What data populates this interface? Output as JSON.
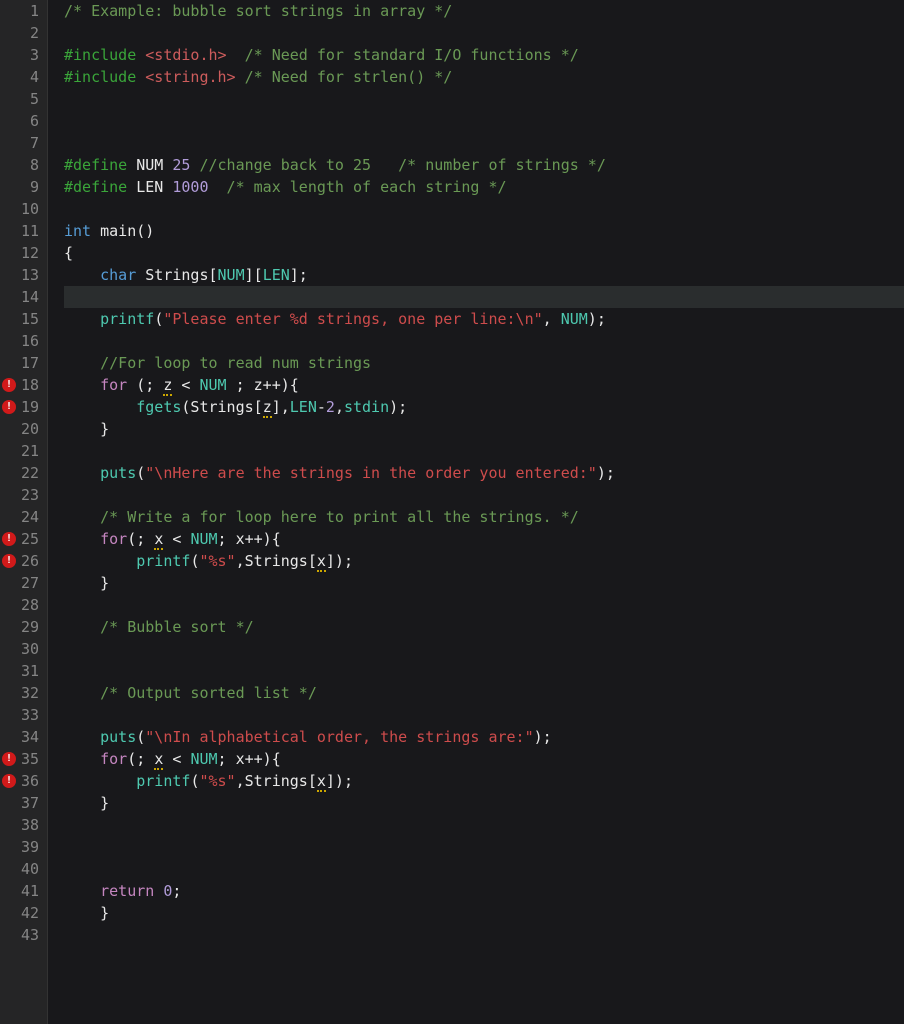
{
  "editor": {
    "total_lines": 43,
    "current_line": 14,
    "error_lines": [
      18,
      19,
      25,
      26,
      35,
      36
    ],
    "lines": {
      "1": [
        {
          "cls": "c-comment",
          "t": "/* Example: bubble sort strings in array */"
        }
      ],
      "2": [],
      "3": [
        {
          "cls": "c-preproc-green",
          "t": "#include "
        },
        {
          "cls": "c-include",
          "t": "<stdio.h>"
        },
        {
          "cls": "c-comment",
          "t": "  /* Need for standard I/O functions */"
        }
      ],
      "4": [
        {
          "cls": "c-preproc-green",
          "t": "#include "
        },
        {
          "cls": "c-include",
          "t": "<string.h>"
        },
        {
          "cls": "c-comment",
          "t": " /* Need for strlen() */"
        }
      ],
      "5": [],
      "6": [],
      "7": [],
      "8": [
        {
          "cls": "c-preproc-green",
          "t": "#define"
        },
        {
          "cls": "c-define-name",
          "t": " NUM "
        },
        {
          "cls": "c-number",
          "t": "25"
        },
        {
          "cls": "c-comment",
          "t": " //change back to 25   /* number of strings */"
        }
      ],
      "9": [
        {
          "cls": "c-preproc-green",
          "t": "#define"
        },
        {
          "cls": "c-define-name",
          "t": " LEN "
        },
        {
          "cls": "c-number",
          "t": "1000"
        },
        {
          "cls": "c-comment",
          "t": "  /* max length of each string */"
        }
      ],
      "10": [],
      "11": [
        {
          "cls": "c-type",
          "t": "int"
        },
        {
          "cls": "c-ident",
          "t": " main"
        },
        {
          "cls": "c-punct",
          "t": "()"
        }
      ],
      "12": [
        {
          "cls": "c-punct",
          "t": "{"
        }
      ],
      "13": [
        {
          "cls": "c-ident",
          "t": "    "
        },
        {
          "cls": "c-type",
          "t": "char"
        },
        {
          "cls": "c-ident",
          "t": " Strings["
        },
        {
          "cls": "c-macro",
          "t": "NUM"
        },
        {
          "cls": "c-ident",
          "t": "]["
        },
        {
          "cls": "c-macro",
          "t": "LEN"
        },
        {
          "cls": "c-ident",
          "t": "];"
        }
      ],
      "14": [],
      "15": [
        {
          "cls": "c-ident",
          "t": "    "
        },
        {
          "cls": "c-func",
          "t": "printf"
        },
        {
          "cls": "c-punct",
          "t": "("
        },
        {
          "cls": "c-string",
          "t": "\"Please enter %d strings, one per line:\\n\""
        },
        {
          "cls": "c-punct",
          "t": ", "
        },
        {
          "cls": "c-macro",
          "t": "NUM"
        },
        {
          "cls": "c-punct",
          "t": ");"
        }
      ],
      "16": [],
      "17": [
        {
          "cls": "c-ident",
          "t": "    "
        },
        {
          "cls": "c-comment",
          "t": "//For loop to read num strings"
        }
      ],
      "18": [
        {
          "cls": "c-ident",
          "t": "    "
        },
        {
          "cls": "c-keyword",
          "t": "for"
        },
        {
          "cls": "c-ident",
          "t": " (; "
        },
        {
          "cls": "c-ident warn-underline",
          "t": "z"
        },
        {
          "cls": "c-ident",
          "t": " < "
        },
        {
          "cls": "c-macro",
          "t": "NUM"
        },
        {
          "cls": "c-ident",
          "t": " ; z++){"
        }
      ],
      "19": [
        {
          "cls": "c-ident",
          "t": "        "
        },
        {
          "cls": "c-func",
          "t": "fgets"
        },
        {
          "cls": "c-punct",
          "t": "(Strings["
        },
        {
          "cls": "c-ident warn-underline",
          "t": "z"
        },
        {
          "cls": "c-punct",
          "t": "],"
        },
        {
          "cls": "c-macro",
          "t": "LEN"
        },
        {
          "cls": "c-op",
          "t": "-"
        },
        {
          "cls": "c-number",
          "t": "2"
        },
        {
          "cls": "c-punct",
          "t": ","
        },
        {
          "cls": "c-func",
          "t": "stdin"
        },
        {
          "cls": "c-punct",
          "t": ");"
        }
      ],
      "20": [
        {
          "cls": "c-punct",
          "t": "    }"
        }
      ],
      "21": [],
      "22": [
        {
          "cls": "c-ident",
          "t": "    "
        },
        {
          "cls": "c-func",
          "t": "puts"
        },
        {
          "cls": "c-punct",
          "t": "("
        },
        {
          "cls": "c-string",
          "t": "\"\\nHere are the strings in the order you entered:\""
        },
        {
          "cls": "c-punct",
          "t": ");"
        }
      ],
      "23": [],
      "24": [
        {
          "cls": "c-ident",
          "t": "    "
        },
        {
          "cls": "c-comment",
          "t": "/* Write a for loop here to print all the strings. */"
        }
      ],
      "25": [
        {
          "cls": "c-ident",
          "t": "    "
        },
        {
          "cls": "c-keyword",
          "t": "for"
        },
        {
          "cls": "c-ident",
          "t": "(; "
        },
        {
          "cls": "c-ident warn-underline",
          "t": "x"
        },
        {
          "cls": "c-ident",
          "t": " < "
        },
        {
          "cls": "c-macro",
          "t": "NUM"
        },
        {
          "cls": "c-ident",
          "t": "; x++){"
        }
      ],
      "26": [
        {
          "cls": "c-ident",
          "t": "        "
        },
        {
          "cls": "c-func",
          "t": "printf"
        },
        {
          "cls": "c-punct",
          "t": "("
        },
        {
          "cls": "c-string",
          "t": "\"%s\""
        },
        {
          "cls": "c-punct",
          "t": ",Strings["
        },
        {
          "cls": "c-ident warn-underline",
          "t": "x"
        },
        {
          "cls": "c-punct",
          "t": "]);"
        }
      ],
      "27": [
        {
          "cls": "c-punct",
          "t": "    }"
        }
      ],
      "28": [],
      "29": [
        {
          "cls": "c-ident",
          "t": "    "
        },
        {
          "cls": "c-comment",
          "t": "/* Bubble sort */"
        }
      ],
      "30": [],
      "31": [],
      "32": [
        {
          "cls": "c-ident",
          "t": "    "
        },
        {
          "cls": "c-comment",
          "t": "/* Output sorted list */"
        }
      ],
      "33": [],
      "34": [
        {
          "cls": "c-ident",
          "t": "    "
        },
        {
          "cls": "c-func",
          "t": "puts"
        },
        {
          "cls": "c-punct",
          "t": "("
        },
        {
          "cls": "c-string",
          "t": "\"\\nIn alphabetical order, the strings are:\""
        },
        {
          "cls": "c-punct",
          "t": ");"
        }
      ],
      "35": [
        {
          "cls": "c-ident",
          "t": "    "
        },
        {
          "cls": "c-keyword",
          "t": "for"
        },
        {
          "cls": "c-ident",
          "t": "(; "
        },
        {
          "cls": "c-ident warn-underline",
          "t": "x"
        },
        {
          "cls": "c-ident",
          "t": " < "
        },
        {
          "cls": "c-macro",
          "t": "NUM"
        },
        {
          "cls": "c-ident",
          "t": "; x++){"
        }
      ],
      "36": [
        {
          "cls": "c-ident",
          "t": "        "
        },
        {
          "cls": "c-func",
          "t": "printf"
        },
        {
          "cls": "c-punct",
          "t": "("
        },
        {
          "cls": "c-string",
          "t": "\"%s\""
        },
        {
          "cls": "c-punct",
          "t": ",Strings["
        },
        {
          "cls": "c-ident warn-underline",
          "t": "x"
        },
        {
          "cls": "c-punct",
          "t": "]);"
        }
      ],
      "37": [
        {
          "cls": "c-punct",
          "t": "    }"
        }
      ],
      "38": [],
      "39": [],
      "40": [],
      "41": [
        {
          "cls": "c-ident",
          "t": "    "
        },
        {
          "cls": "c-keyword",
          "t": "return"
        },
        {
          "cls": "c-ident",
          "t": " "
        },
        {
          "cls": "c-number",
          "t": "0"
        },
        {
          "cls": "c-punct",
          "t": ";"
        }
      ],
      "42": [
        {
          "cls": "c-punct",
          "t": "    }"
        }
      ],
      "43": []
    }
  }
}
